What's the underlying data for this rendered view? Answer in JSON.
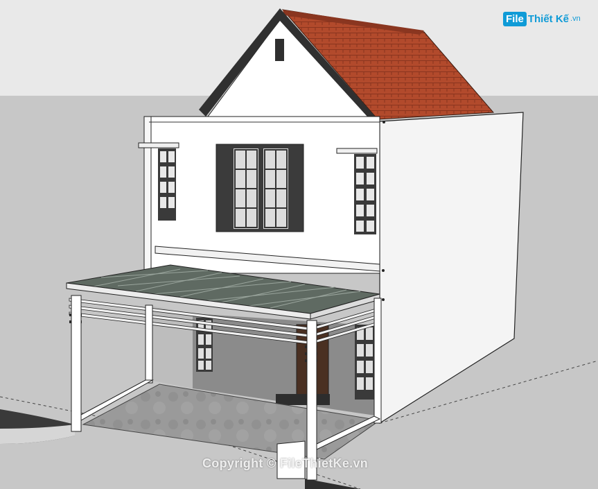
{
  "watermark": {
    "logo_badge": "File",
    "logo_text": "Thiết Kế",
    "logo_suffix": ".vn",
    "copyright": "Copyright © FileThietKe.vn"
  },
  "colors": {
    "sky": "#e9e9e9",
    "ground": "#c7c7c7",
    "wall": "#ffffff",
    "roof_tile": "#b24a2c",
    "roof_trim": "#303030",
    "window_frame": "#3a3a3a",
    "canopy_glass": "#5f6a62",
    "interior_wall": "#8b8b8b",
    "floor": "#9a9a9a",
    "door": "#4a3022",
    "logo_blue": "#0f9bd7"
  },
  "icons": [
    "house-3d-model",
    "site-logo"
  ]
}
